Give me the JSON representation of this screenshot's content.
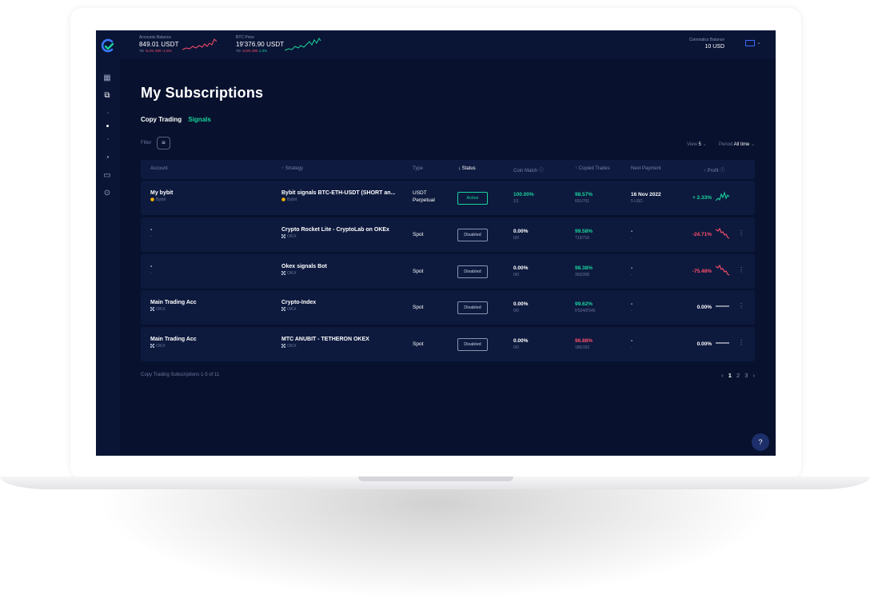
{
  "topbar": {
    "accounts": {
      "label": "Accounts Balance",
      "value": "849.01 USDT",
      "prefix": "7D",
      "change_abs": "-5.4% 300",
      "change_pct": "-1.5%"
    },
    "btc": {
      "label": "BTC Price",
      "value": "19'376.90 USDT",
      "prefix": "7D",
      "change_abs": "-3.8% 300",
      "change_pct": "1.3%"
    },
    "balance": {
      "label": "Coinmatics Balance",
      "value": "10 USD"
    }
  },
  "page": {
    "title": "My Subscriptions",
    "tabs": [
      {
        "label": "Copy Trading"
      },
      {
        "label": "Signals"
      }
    ],
    "filter_label": "Filter",
    "view_label": "View",
    "view_value": "5",
    "period_label": "Period",
    "period_value": "All time"
  },
  "table": {
    "headers": {
      "account": "Account",
      "strategy": "↑ Strategy",
      "type": "Type",
      "status": "↓ Status",
      "coin_match": "Coin Match",
      "copied": "↑ Copied Trades",
      "next_payment": "Next Payment",
      "profit": "↑ Profit"
    },
    "rows": [
      {
        "account": "My bybit",
        "account_ex": "Bybit",
        "strategy": "Bybit signals BTC-ETH-USDT (SHORT an...",
        "strategy_ex": "Bybit",
        "type1": "USDT",
        "type2": "Perpetual",
        "status": "Active",
        "coin": "100.00%",
        "coin_sub": "1/1",
        "copied": "98.57%",
        "copied_sub": "691/701",
        "next": "16 Nov 2022",
        "next_sub": "5 USD",
        "profit": "+ 2.33%",
        "trend": "up"
      },
      {
        "account": "-",
        "account_ex": "-",
        "strategy": "Crypto Rocket Lite - CryptoLab on OKEx",
        "strategy_ex": "OKX",
        "type1": "Spot",
        "type2": "",
        "status": "Disabled",
        "coin": "0.00%",
        "coin_sub": "0/0",
        "copied": "99.58%",
        "copied_sub": "713/716",
        "next": "-",
        "next_sub": "-",
        "profit": "-24.71%",
        "trend": "down"
      },
      {
        "account": "-",
        "account_ex": "-",
        "strategy": "Okex signals Bot",
        "strategy_ex": "OKX",
        "type1": "Spot",
        "type2": "",
        "status": "Disabled",
        "coin": "0.00%",
        "coin_sub": "0/0",
        "copied": "98.38%",
        "copied_sub": "303/308",
        "next": "-",
        "next_sub": "-",
        "profit": "-75.48%",
        "trend": "down"
      },
      {
        "account": "Main Trading Acc",
        "account_ex": "OKX",
        "strategy": "Crypto-Index",
        "strategy_ex": "OKX",
        "type1": "Spot",
        "type2": "",
        "status": "Disabled",
        "coin": "0.00%",
        "coin_sub": "0/0",
        "copied": "99.62%",
        "copied_sub": "5'524/5'545",
        "next": "-",
        "next_sub": "-",
        "profit": "0.00%",
        "trend": "flat"
      },
      {
        "account": "Main Trading Acc",
        "account_ex": "OKX",
        "strategy": "MTC ANUBIT - TETHERON OKEX",
        "strategy_ex": "OKX",
        "type1": "Spot",
        "type2": "",
        "status": "Disabled",
        "coin": "0.00%",
        "coin_sub": "0/0",
        "copied": "96.88%",
        "copied_sub": "186/192",
        "next": "-",
        "next_sub": "-",
        "profit": "0.00%",
        "trend": "flat"
      }
    ]
  },
  "footer": {
    "summary": "Copy Trading Subscriptions 1-5 of 11",
    "pages": [
      "1",
      "2",
      "3"
    ]
  },
  "colors": {
    "bg": "#08112e",
    "panel": "#0d1a3e",
    "accent": "#19d39b",
    "negative": "#ff4d6a"
  },
  "icons": {
    "help": "question-circle-icon"
  }
}
